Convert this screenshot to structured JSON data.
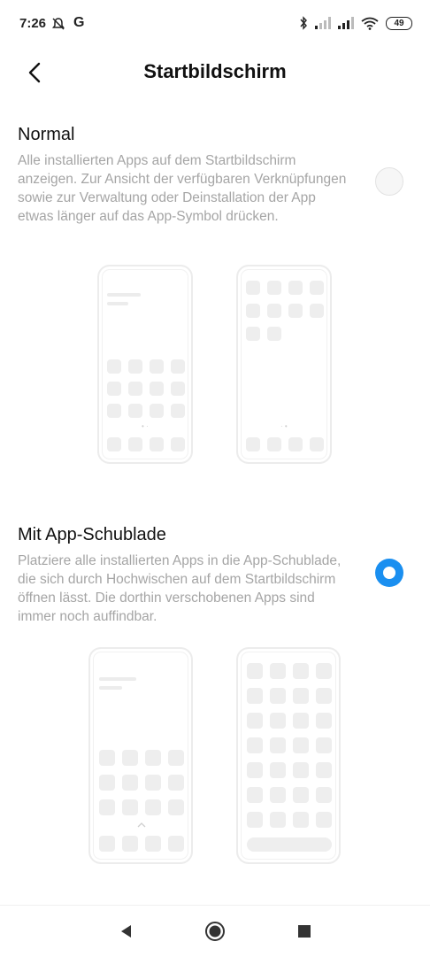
{
  "status_bar": {
    "time": "7:26",
    "carrier": "G",
    "battery": "49",
    "icons": [
      "notifications-off-icon",
      "bluetooth-icon",
      "signal-icon",
      "signal-icon",
      "wifi-icon"
    ]
  },
  "header": {
    "title": "Startbildschirm",
    "back_icon": "chevron-left-icon"
  },
  "options": [
    {
      "title": "Normal",
      "description": "Alle installierten Apps auf dem Startbildschirm anzeigen. Zur Ansicht der verfügbaren Verknüpfungen sowie zur Verwaltung oder Deinstallation der App etwas länger auf das App-Symbol drücken.",
      "selected": false
    },
    {
      "title": "Mit App-Schublade",
      "description": "Platziere alle installierten Apps in die App-Schublade, die sich durch Hochwischen auf dem Startbildschirm öffnen lässt. Die dorthin verschobenen Apps sind immer noch auffindbar.",
      "selected": true
    }
  ],
  "colors": {
    "accent": "#1a8ff0",
    "text_secondary": "#a5a5a5",
    "illustration": "#eeeeee"
  },
  "navbar": {
    "icons": [
      "back-triangle-icon",
      "home-circle-icon",
      "recents-square-icon"
    ]
  }
}
